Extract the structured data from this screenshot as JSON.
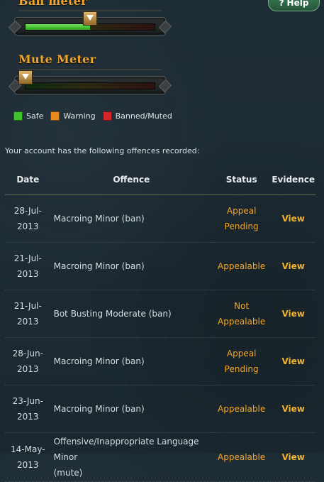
{
  "ban_meter": {
    "title": "Ban meter",
    "level": 0.5
  },
  "mute_meter": {
    "title": "Mute Meter",
    "level": 0.0
  },
  "help": {
    "icon": "question-icon",
    "label": "Help"
  },
  "legend": [
    {
      "label": "Safe",
      "color": "#3ec42d"
    },
    {
      "label": "Warning",
      "color": "#e88a1c"
    },
    {
      "label": "Banned/Muted",
      "color": "#d4262a"
    }
  ],
  "intro": "Your account has the following offences recorded:",
  "table": {
    "headers": [
      "Date",
      "Offence",
      "Status",
      "Evidence"
    ],
    "rows": [
      {
        "date": "28-Jul-\n2013",
        "offence": "Macroing Minor (ban)",
        "status": "Appeal\nPending",
        "evidence": "View"
      },
      {
        "date": "21-Jul-\n2013",
        "offence": "Macroing Minor (ban)",
        "status": "Appealable",
        "evidence": "View"
      },
      {
        "date": "21-Jul-\n2013",
        "offence": "Bot Busting Moderate (ban)",
        "status": "Not\nAppealable",
        "evidence": "View"
      },
      {
        "date": "28-Jun-\n2013",
        "offence": "Macroing Minor (ban)",
        "status": "Appeal\nPending",
        "evidence": "View"
      },
      {
        "date": "23-Jun-\n2013",
        "offence": "Macroing Minor (ban)",
        "status": "Appealable",
        "evidence": "View"
      },
      {
        "date": "14-May-\n2013",
        "offence": "Offensive/Inappropriate Language Minor\n(mute)",
        "status": "Appealable",
        "evidence": "View"
      }
    ]
  }
}
